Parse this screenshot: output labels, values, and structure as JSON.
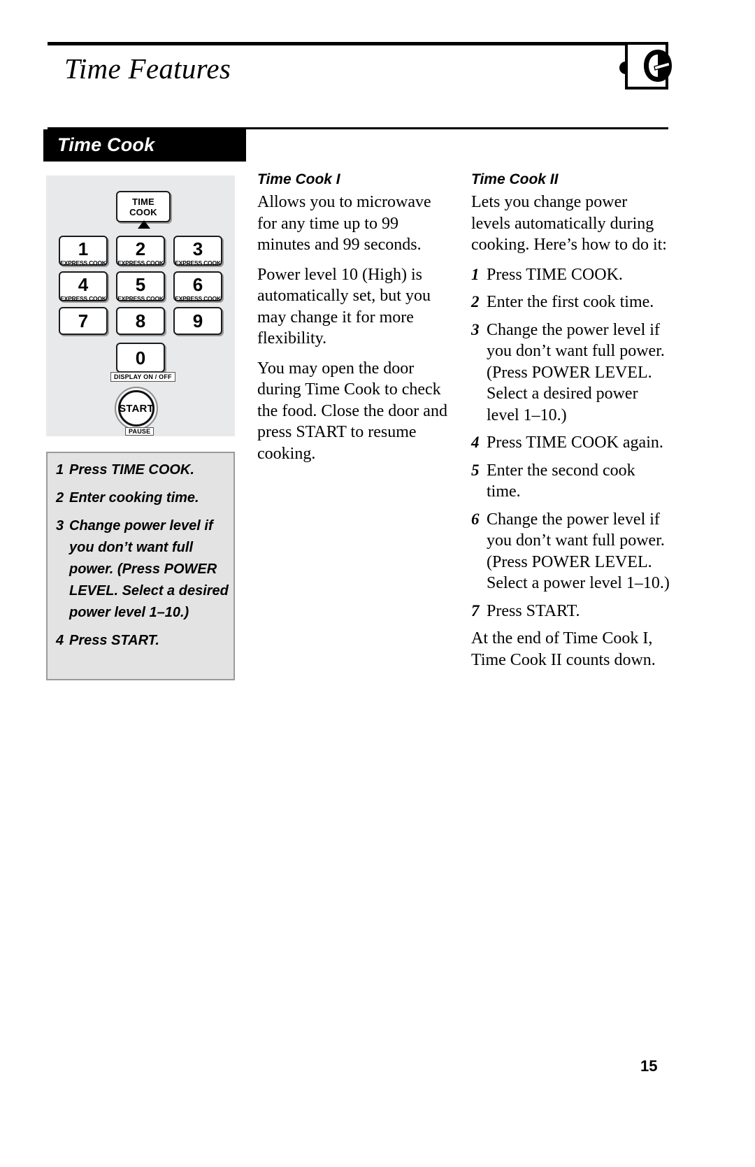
{
  "header": {
    "title": "Time Features",
    "logo_alt": "ge-monogram"
  },
  "section": {
    "band_label": "Time Cook"
  },
  "control_panel": {
    "time_cook_key": "TIME COOK",
    "express_cook_sub": "EXPRESS COOK",
    "keys": [
      {
        "num": "1",
        "sub": "EXPRESS COOK"
      },
      {
        "num": "2",
        "sub": "EXPRESS COOK"
      },
      {
        "num": "3",
        "sub": "EXPRESS COOK"
      },
      {
        "num": "4",
        "sub": "EXPRESS COOK"
      },
      {
        "num": "5",
        "sub": "EXPRESS COOK"
      },
      {
        "num": "6",
        "sub": "EXPRESS COOK"
      },
      {
        "num": "7",
        "sub": ""
      },
      {
        "num": "8",
        "sub": ""
      },
      {
        "num": "9",
        "sub": ""
      },
      {
        "num": "0",
        "sub": ""
      }
    ],
    "display_on_off": "DISPLAY ON / OFF",
    "start_key": "START",
    "pause_label": "PAUSE"
  },
  "steps_box": {
    "steps": [
      {
        "n": "1",
        "text": "Press TIME COOK."
      },
      {
        "n": "2",
        "text": "Enter cooking time."
      },
      {
        "n": "3",
        "text": "Change power level if you don’t want full power. (Press POWER LEVEL. Select a desired power level 1–10.)"
      },
      {
        "n": "4",
        "text": "Press START."
      }
    ]
  },
  "time_cook_i": {
    "heading": "Time Cook I",
    "paragraphs": [
      "Allows you to microwave for any time up to 99 minutes and 99 seconds.",
      "Power level 10 (High) is automatically set, but you may change it for more flexibility.",
      "You may open the door during Time Cook to check the food. Close the door and press START to resume cooking."
    ]
  },
  "time_cook_ii": {
    "heading": "Time Cook II",
    "intro": "Lets you change power levels automatically during cooking. Here’s how to do it:",
    "steps": [
      {
        "n": "1",
        "text": "Press TIME COOK."
      },
      {
        "n": "2",
        "text": "Enter the first cook time."
      },
      {
        "n": "3",
        "text": "Change the power level if you don’t want full power. (Press POWER LEVEL. Select a desired power level 1–10.)"
      },
      {
        "n": "4",
        "text": "Press TIME COOK again."
      },
      {
        "n": "5",
        "text": "Enter the second cook time."
      },
      {
        "n": "6",
        "text": "Change the power level if you don’t want full power. (Press POWER LEVEL. Select a power level 1–10.)"
      },
      {
        "n": "7",
        "text": "Press START."
      }
    ],
    "closing": "At the end of Time Cook I, Time Cook II counts down."
  },
  "footer": {
    "page_number": "15"
  }
}
